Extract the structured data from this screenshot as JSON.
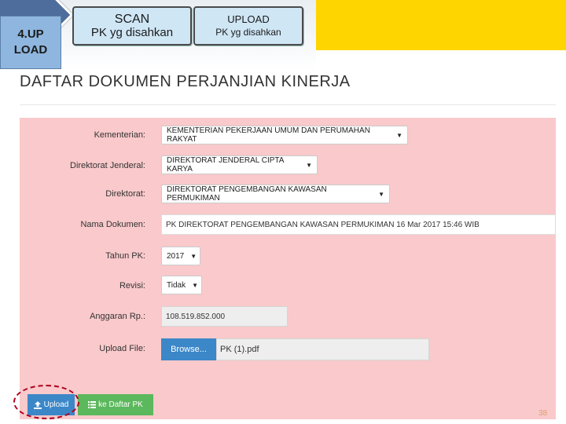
{
  "banner": {
    "step_badge": "4.UP\nLOAD",
    "scan": {
      "line1": "SCAN",
      "line2": "PK  yg disahkan"
    },
    "upload": {
      "line1": "UPLOAD",
      "line2": "PK yg disahkan"
    },
    "accent_color": "#ffd500"
  },
  "page": {
    "title": "DAFTAR DOKUMEN PERJANJIAN KINERJA",
    "page_number": "38"
  },
  "form": {
    "kementerian": {
      "label": "Kementerian:",
      "value": "KEMENTERIAN PEKERJAAN UMUM DAN PERUMAHAN RAKYAT"
    },
    "direktorat_jenderal": {
      "label": "Direktorat Jenderal:",
      "value": "DIREKTORAT JENDERAL CIPTA KARYA"
    },
    "direktorat": {
      "label": "Direktorat:",
      "value": "DIREKTORAT PENGEMBANGAN KAWASAN PERMUKIMAN"
    },
    "nama_dokumen": {
      "label": "Nama Dokumen:",
      "value": "PK DIREKTORAT PENGEMBANGAN KAWASAN PERMUKIMAN 16 Mar 2017 15:46 WIB"
    },
    "tahun_pk": {
      "label": "Tahun PK:",
      "value": "2017"
    },
    "revisi": {
      "label": "Revisi:",
      "value": "Tidak"
    },
    "anggaran": {
      "label": "Anggaran Rp.:",
      "value": "108.519.852.000"
    },
    "upload_file": {
      "label": "Upload File:",
      "browse_label": "Browse...",
      "file_name": "PK (1).pdf"
    }
  },
  "actions": {
    "upload_label": "Upload",
    "daftar_label": "ke Daftar PK",
    "upload_icon": "upload-icon",
    "list_icon": "list-icon"
  },
  "colors": {
    "panel": "#f9c9cb",
    "primary": "#3b87c8",
    "success": "#5cb85c",
    "highlight": "#b0001e"
  }
}
